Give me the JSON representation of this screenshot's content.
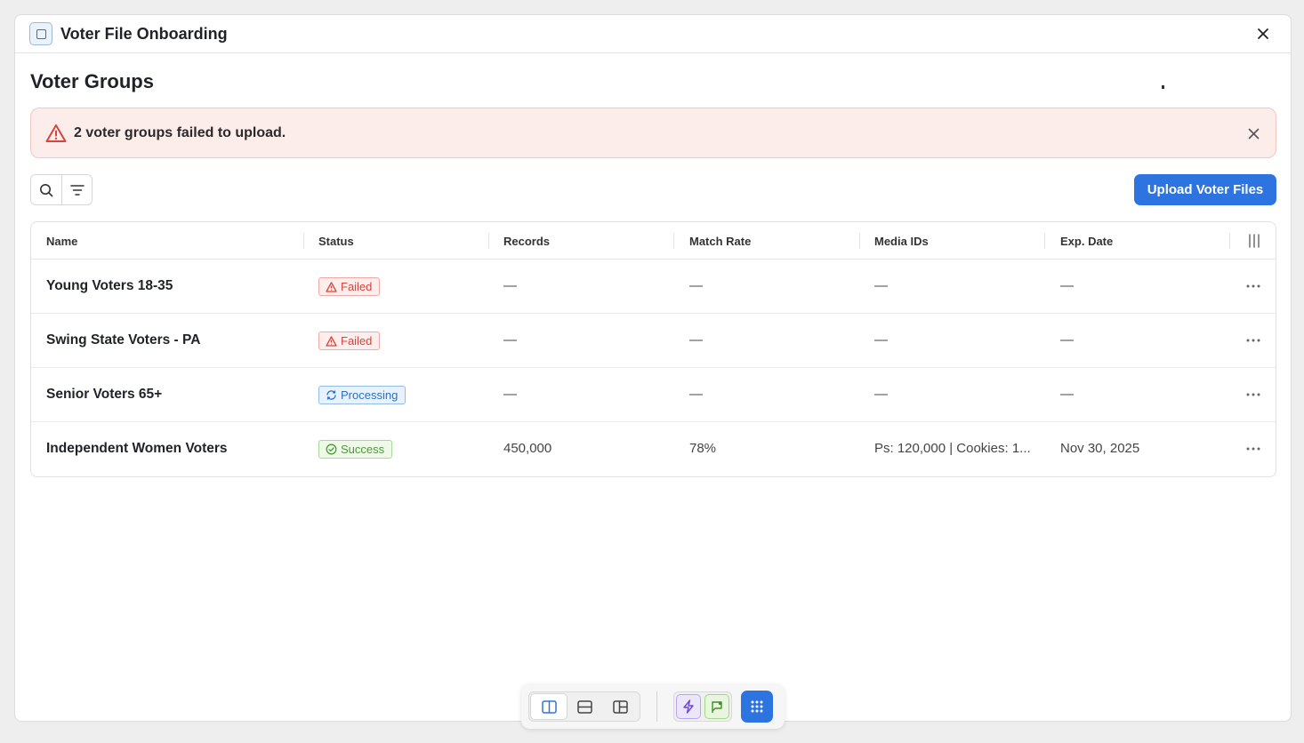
{
  "window": {
    "title": "Voter File Onboarding"
  },
  "page": {
    "title": "Voter Groups"
  },
  "alert": {
    "message": "2 voter groups failed to upload."
  },
  "toolbar": {
    "upload_label": "Upload Voter Files"
  },
  "table": {
    "columns": [
      "Name",
      "Status",
      "Records",
      "Match Rate",
      "Media IDs",
      "Exp. Date"
    ],
    "rows": [
      {
        "name": "Young Voters 18-35",
        "status": "Failed",
        "records": "—",
        "match_rate": "—",
        "media_ids": "—",
        "exp_date": "—"
      },
      {
        "name": "Swing State Voters - PA",
        "status": "Failed",
        "records": "—",
        "match_rate": "—",
        "media_ids": "—",
        "exp_date": "—"
      },
      {
        "name": "Senior Voters 65+",
        "status": "Processing",
        "records": "—",
        "match_rate": "—",
        "media_ids": "—",
        "exp_date": "—"
      },
      {
        "name": "Independent Women Voters",
        "status": "Success",
        "records": "450,000",
        "match_rate": "78%",
        "media_ids": "Ps: 120,000 | Cookies: 1...",
        "exp_date": "Nov 30, 2025"
      }
    ]
  },
  "colors": {
    "accent": "#2d74e0",
    "failed": "#d4453b",
    "processing": "#2f6fbf",
    "success": "#4a9a3a",
    "alert_bg": "#fcecea"
  }
}
